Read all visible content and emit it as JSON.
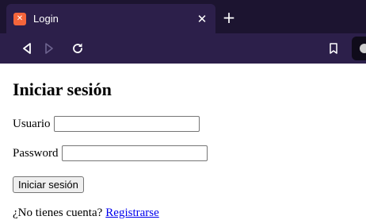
{
  "browser": {
    "tab": {
      "title": "Login",
      "favicon": "xampp-logo-icon",
      "favicon_glyph": "✕",
      "close_glyph": "✕"
    },
    "new_tab_glyph": "+",
    "icons": {
      "back": "back-arrow-icon",
      "forward": "forward-arrow-icon",
      "reload": "reload-icon",
      "bookmark": "bookmark-icon",
      "account": "account-icon"
    },
    "colors": {
      "chrome_bg": "#2c1f4a",
      "tabbar_bg": "#1c1430",
      "favicon_bg": "#f5653b"
    }
  },
  "page": {
    "title": "Iniciar sesión",
    "username": {
      "label": "Usuario",
      "value": ""
    },
    "password": {
      "label": "Password",
      "value": ""
    },
    "submit_label": "Iniciar sesión",
    "register_prompt": "¿No tienes cuenta?",
    "register_link": "Registrarse",
    "colors": {
      "link": "#0000ee"
    }
  }
}
